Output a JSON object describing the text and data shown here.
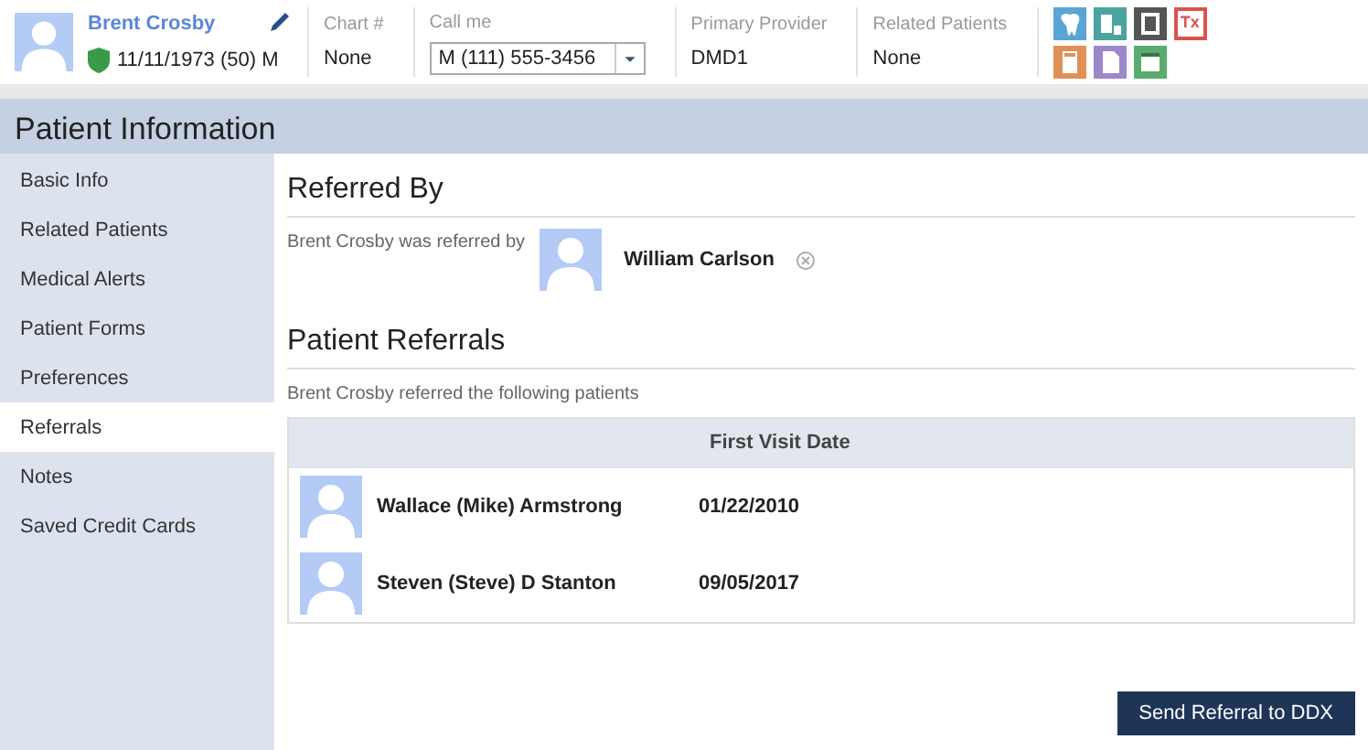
{
  "patient": {
    "name": "Brent Crosby",
    "dob": "11/11/1973 (50) M"
  },
  "fields": [
    {
      "label": "Chart #",
      "value": "None",
      "kind": "text"
    },
    {
      "label": "Call me",
      "value": "M (111) 555-3456",
      "kind": "select"
    },
    {
      "label": "Primary Provider",
      "value": "DMD1",
      "kind": "text"
    },
    {
      "label": "Related Patients",
      "value": "None",
      "kind": "text"
    }
  ],
  "tools": [
    [
      {
        "kind": "tooth",
        "color": "#5ba4d6"
      },
      {
        "kind": "chart",
        "color": "#4aa3a0"
      },
      {
        "kind": "film",
        "color": "#555555"
      },
      {
        "kind": "text",
        "color": "#d9534f",
        "label": "Tx"
      }
    ],
    [
      {
        "kind": "calculator",
        "color": "#e0915a"
      },
      {
        "kind": "document",
        "color": "#9b87c9"
      },
      {
        "kind": "calendar",
        "color": "#5cab6e"
      }
    ]
  ],
  "page_title": "Patient Information",
  "sidebar": {
    "items": [
      {
        "label": "Basic Info",
        "selected": false
      },
      {
        "label": "Related Patients",
        "selected": false
      },
      {
        "label": "Medical Alerts",
        "selected": false
      },
      {
        "label": "Patient Forms",
        "selected": false
      },
      {
        "label": "Preferences",
        "selected": false
      },
      {
        "label": "Referrals",
        "selected": true
      },
      {
        "label": "Notes",
        "selected": false
      },
      {
        "label": "Saved Credit Cards",
        "selected": false
      }
    ]
  },
  "referred_by": {
    "heading": "Referred By",
    "text": "Brent Crosby was referred by",
    "name": "William Carlson"
  },
  "referrals": {
    "heading": "Patient Referrals",
    "text": "Brent Crosby referred the following patients",
    "columns": [
      "First Visit Date"
    ],
    "rows": [
      {
        "name": "Wallace (Mike) Armstrong",
        "date": "01/22/2010"
      },
      {
        "name": "Steven (Steve) D Stanton",
        "date": "09/05/2017"
      }
    ]
  },
  "button": "Send Referral to DDX"
}
